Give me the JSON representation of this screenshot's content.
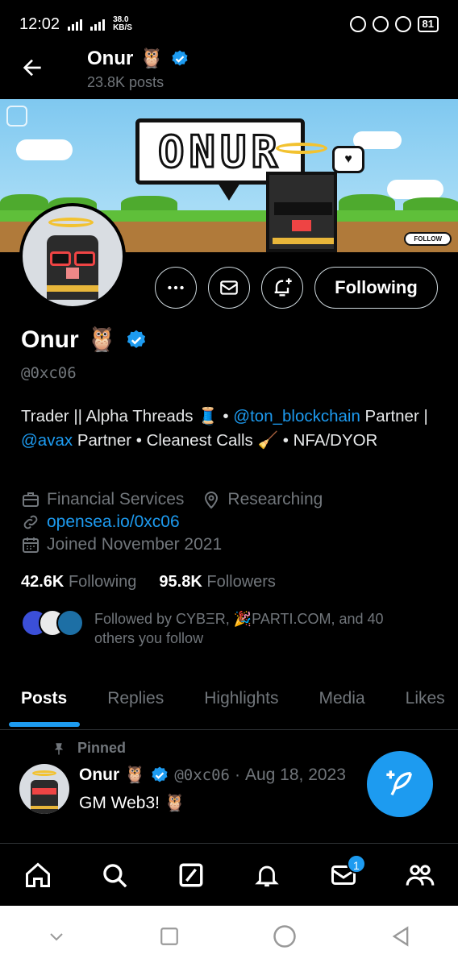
{
  "status_bar": {
    "time": "12:02",
    "net_speed": "38.0",
    "net_unit": "KB/S",
    "battery": "81"
  },
  "header": {
    "name": "Onur",
    "emoji": "🦉",
    "posts": "23.8K posts"
  },
  "banner": {
    "sign_text": "ONUR",
    "follow_chip": "FOLLOW"
  },
  "actions": {
    "following_label": "Following"
  },
  "profile": {
    "name": "Onur",
    "emoji": "🦉",
    "handle": "@0xc06",
    "bio_part1": "Trader || Alpha Threads 🧵 • ",
    "bio_link1": "@ton_blockchain",
    "bio_part2": " Partner | ",
    "bio_link2": "@avax",
    "bio_part3": " Partner • Cleanest Calls 🧹 • NFA/DYOR",
    "category": "Financial Services",
    "location": "Researching",
    "website": "opensea.io/0xc06",
    "joined": "Joined November 2021",
    "following_count": "42.6K",
    "following_label": "Following",
    "followers_count": "95.8K",
    "followers_label": "Followers",
    "followed_by": "Followed by CYBΞR, 🎉PARTI.COM, and 40 others you follow"
  },
  "tabs": [
    {
      "label": "Posts"
    },
    {
      "label": "Replies"
    },
    {
      "label": "Highlights"
    },
    {
      "label": "Media"
    },
    {
      "label": "Likes"
    }
  ],
  "pinned_post": {
    "pinned_label": "Pinned",
    "name": "Onur",
    "emoji": "🦉",
    "handle": "@0xc06",
    "separator": "·",
    "date": "Aug 18, 2023",
    "text": "GM Web3! 🦉"
  },
  "bottom_nav": {
    "messages_badge": "1",
    "items": [
      "home-icon",
      "search-icon",
      "grok-icon",
      "notifications-icon",
      "messages-icon",
      "communities-icon"
    ]
  },
  "colors": {
    "accent": "#1d9bf0",
    "muted": "#71767b",
    "background": "#000000"
  }
}
